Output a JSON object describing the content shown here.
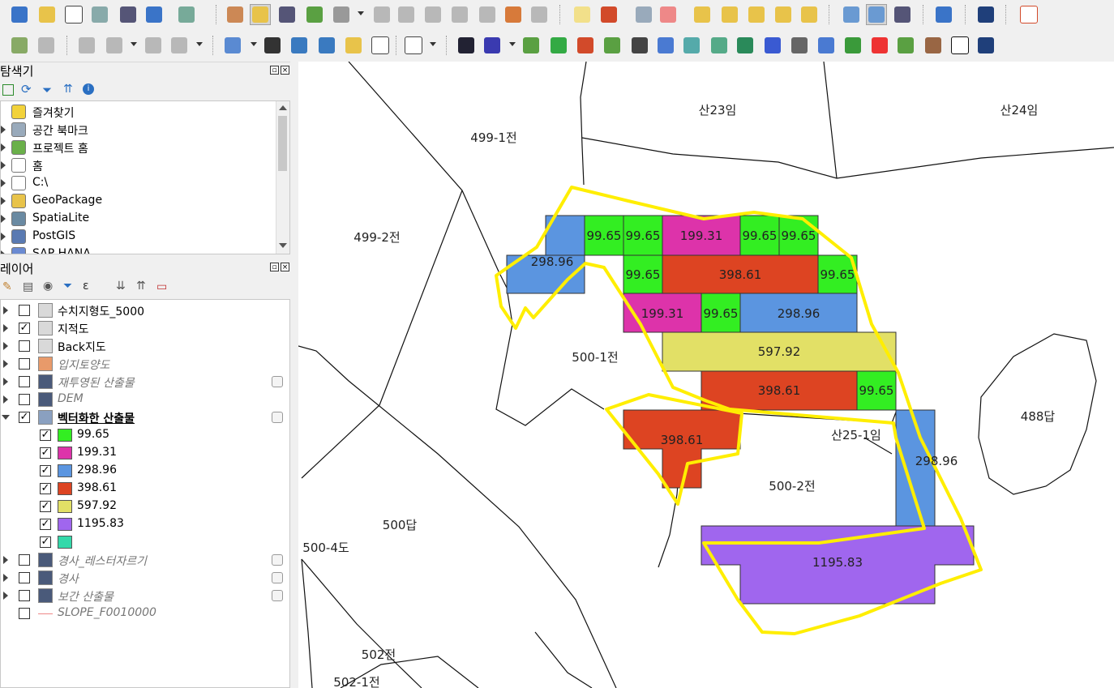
{
  "browser_panel": {
    "title": "탐색기",
    "items": [
      {
        "label": "즐겨찾기",
        "icon": "star-icon"
      },
      {
        "label": "공간 북마크",
        "icon": "bookmark-icon"
      },
      {
        "label": "프로젝트 홈",
        "icon": "project-home-icon"
      },
      {
        "label": "홈",
        "icon": "home-icon"
      },
      {
        "label": "C:\\",
        "icon": "folder-icon"
      },
      {
        "label": "GeoPackage",
        "icon": "geopackage-icon"
      },
      {
        "label": "SpatiaLite",
        "icon": "spatialite-icon"
      },
      {
        "label": "PostGIS",
        "icon": "postgis-icon"
      },
      {
        "label": "SAP HANA",
        "icon": "database-icon"
      }
    ]
  },
  "layers_panel": {
    "title": "레이어",
    "layers": [
      {
        "label": "수치지형도_5000",
        "checked": false,
        "visible": true
      },
      {
        "label": "지적도",
        "checked": true,
        "visible": true
      },
      {
        "label": "Back지도",
        "checked": false,
        "visible": true
      },
      {
        "label": "입지토양도",
        "checked": false,
        "visible": false
      },
      {
        "label": "재투영된 산출물",
        "checked": false,
        "visible": false
      },
      {
        "label": "DEM",
        "checked": false,
        "visible": false
      },
      {
        "label": "벡터화한 산출물",
        "checked": true,
        "visible": true
      }
    ],
    "legend": [
      {
        "label": "99.65",
        "color": "#33ee22"
      },
      {
        "label": "199.31",
        "color": "#dd33aa"
      },
      {
        "label": "298.96",
        "color": "#5b95e0"
      },
      {
        "label": "398.61",
        "color": "#dd4422"
      },
      {
        "label": "597.92",
        "color": "#e2e066"
      },
      {
        "label": "1195.83",
        "color": "#a066ee"
      },
      {
        "label": "",
        "color": "#33d9aa"
      }
    ],
    "layers_after": [
      {
        "label": "경사_레스터자르기",
        "checked": false
      },
      {
        "label": "경사",
        "checked": false
      },
      {
        "label": "보간 산출물",
        "checked": false
      },
      {
        "label": "SLOPE_F0010000",
        "checked": false
      }
    ]
  },
  "map": {
    "parcel_labels": [
      "산23임",
      "산24임",
      "499-1전",
      "499-2전",
      "500-1전",
      "488답",
      "산25-1임",
      "500-2전",
      "500답",
      "500-4도",
      "502전",
      "502-1전"
    ],
    "cell_values": [
      "298.96",
      "99.65",
      "99.65",
      "199.31",
      "99.65",
      "99.65",
      "99.65",
      "398.61",
      "99.65",
      "199.31",
      "99.65",
      "298.96",
      "597.92",
      "398.61",
      "99.65",
      "398.61",
      "298.96",
      "1195.83"
    ],
    "highlight_color": "#ffee00"
  }
}
